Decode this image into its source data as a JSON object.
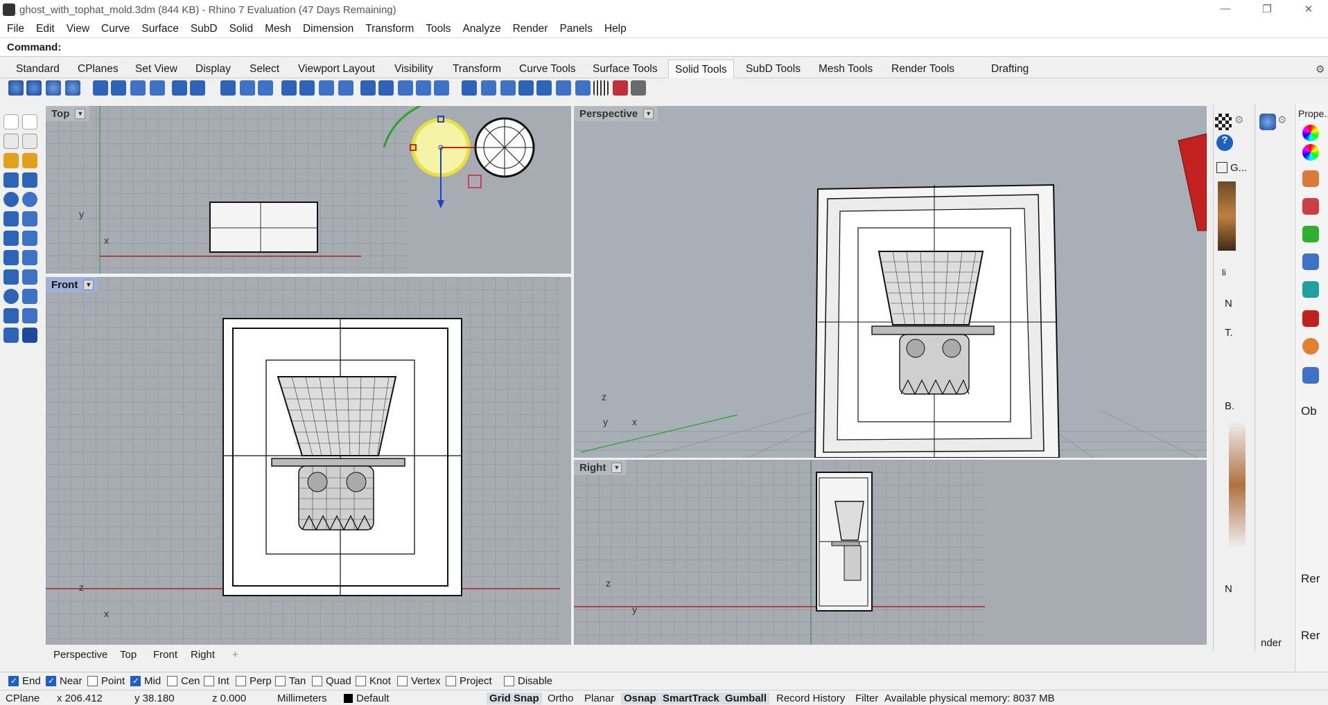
{
  "window": {
    "title": "ghost_with_tophat_mold.3dm (844 KB) - Rhino 7 Evaluation (47 Days Remaining)"
  },
  "menu": [
    "File",
    "Edit",
    "View",
    "Curve",
    "Surface",
    "SubD",
    "Solid",
    "Mesh",
    "Dimension",
    "Transform",
    "Tools",
    "Analyze",
    "Render",
    "Panels",
    "Help"
  ],
  "command": {
    "label": "Command:"
  },
  "toolbar_tabs": [
    "Standard",
    "CPlanes",
    "Set View",
    "Display",
    "Select",
    "Viewport Layout",
    "Visibility",
    "Transform",
    "Curve Tools",
    "Surface Tools",
    "Solid Tools",
    "SubD Tools",
    "Mesh Tools",
    "Render Tools",
    "Drafting"
  ],
  "active_tab": "Solid Tools",
  "viewports": {
    "top": {
      "label": "Top",
      "axis_y": "y",
      "axis_x": "x"
    },
    "front": {
      "label": "Front",
      "axis_y": "z",
      "axis_x": "x"
    },
    "perspective": {
      "label": "Perspective",
      "axis_z": "z",
      "axis_y": "y",
      "axis_x": "x"
    },
    "right": {
      "label": "Right",
      "axis_z": "z",
      "axis_y": "y"
    }
  },
  "viewport_tabs": [
    "Perspective",
    "Top",
    "Front",
    "Right",
    "+"
  ],
  "osnaps": [
    {
      "label": "End",
      "checked": true
    },
    {
      "label": "Near",
      "checked": true
    },
    {
      "label": "Point",
      "checked": false
    },
    {
      "label": "Mid",
      "checked": true
    },
    {
      "label": "Cen",
      "checked": false
    },
    {
      "label": "Int",
      "checked": false
    },
    {
      "label": "Perp",
      "checked": false
    },
    {
      "label": "Tan",
      "checked": false
    },
    {
      "label": "Quad",
      "checked": false
    },
    {
      "label": "Knot",
      "checked": false
    },
    {
      "label": "Vertex",
      "checked": false
    },
    {
      "label": "Project",
      "checked": false
    },
    {
      "label": "Disable",
      "checked": false
    }
  ],
  "status": {
    "cplane": "CPlane",
    "x": "x 206.412",
    "y": "y 38.180",
    "z": "z 0.000",
    "units": "Millimeters",
    "layer": "Default",
    "toggles": [
      "Grid Snap",
      "Ortho",
      "Planar",
      "Osnap",
      "SmartTrack",
      "Gumball",
      "Record History",
      "Filter"
    ],
    "memory": "Available physical memory: 8037 MB"
  },
  "right_panel": {
    "tab1": "G...",
    "item_n": "N",
    "item_t": "T.",
    "item_b": "B.",
    "item_li": "li",
    "item_n2": "N",
    "props": "Prope...",
    "ob": "Ob",
    "rer1": "Rer",
    "rer2": "Rer",
    "nder": "nder"
  }
}
